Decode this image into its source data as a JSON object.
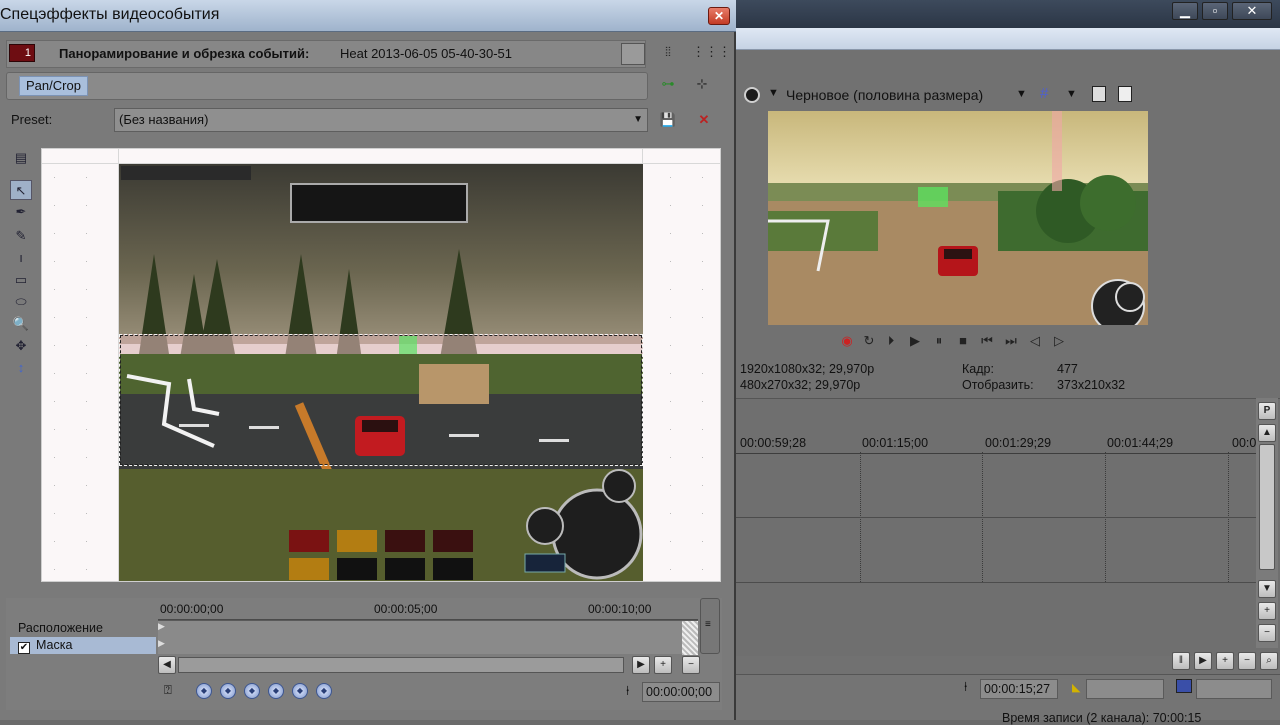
{
  "fx_window": {
    "title": "Спецэффекты видеособытия",
    "close_icon": "✕",
    "plugin_badge": "1",
    "header_label": "Панорамирование и обрезка событий:",
    "event_name": "Heat 2013-06-05 05-40-30-51",
    "chain_item": "Pan/Crop",
    "preset_label": "Preset:",
    "preset_value": "(Без названия)",
    "keyframes": {
      "ruler": [
        "00:00:00;00",
        "00:00:05;00",
        "00:00:10;00"
      ],
      "tracks": [
        {
          "label": "Расположение"
        },
        {
          "label": "Маска",
          "checked": true,
          "check_mark": "✔"
        }
      ],
      "time_value": "00:00:00;00"
    }
  },
  "main_window": {
    "preview_quality": "Черновое (половина размера)",
    "project_info": "1920x1080x32; 29,970p",
    "preview_info": "480x270x32; 29,970p",
    "frame_label": "Кадр:",
    "frame_value": "477",
    "display_label": "Отобразить:",
    "display_value": "373x210x32",
    "timeline_ruler": [
      "00:00:59;28",
      "00:01:15;00",
      "00:01:29;29",
      "00:01:44;29",
      "00:0"
    ],
    "status_time": "00:00:15;27",
    "status_bottom": "Время записи (2 канала): 70:00:15"
  }
}
